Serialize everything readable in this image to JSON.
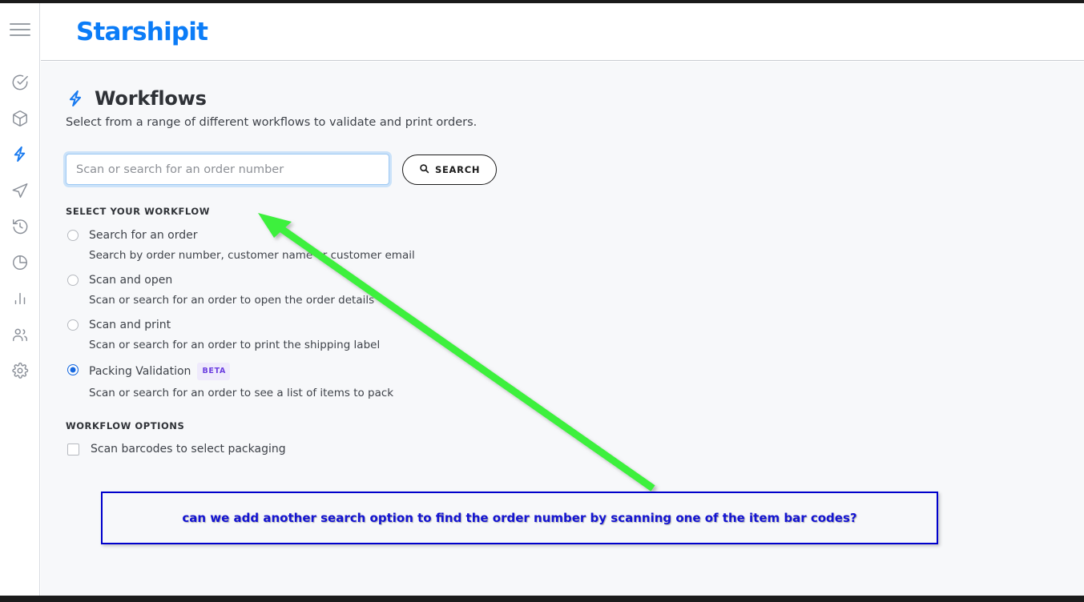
{
  "brand": {
    "logo_text": "Starshipit",
    "accent_color": "#0b7cf7",
    "active_nav_color": "#1a7bf0",
    "badge_color": "#6c3fe0",
    "annotation_color": "#0000cc",
    "arrow_color": "#3cf03c"
  },
  "sidebar": {
    "menu_label": "Menu",
    "items": [
      {
        "icon": "check-circle-icon",
        "label": "Orders awaiting fulfilment"
      },
      {
        "icon": "package-icon",
        "label": "Packages"
      },
      {
        "icon": "lightning-bolt-icon",
        "label": "Workflows",
        "active": true
      },
      {
        "icon": "paper-plane-icon",
        "label": "Shipments"
      },
      {
        "icon": "history-clock-icon",
        "label": "History"
      },
      {
        "icon": "pie-chart-icon",
        "label": "Reports"
      },
      {
        "icon": "bar-chart-icon",
        "label": "Analytics"
      },
      {
        "icon": "users-icon",
        "label": "Customers"
      },
      {
        "icon": "gear-icon",
        "label": "Settings"
      }
    ]
  },
  "page": {
    "icon": "lightning-bolt-icon",
    "title": "Workflows",
    "subtitle": "Select from a range of different workflows to validate and print orders."
  },
  "search": {
    "placeholder": "Scan or search for an order number",
    "value": "",
    "button_label": "SEARCH",
    "button_icon": "search-icon"
  },
  "workflow_section": {
    "heading": "SELECT YOUR WORKFLOW",
    "options": [
      {
        "title": "Search for an order",
        "description": "Search by order number, customer name or customer email",
        "selected": false,
        "badge": ""
      },
      {
        "title": "Scan and open",
        "description": "Scan or search for an order to open the order details",
        "selected": false,
        "badge": ""
      },
      {
        "title": "Scan and print",
        "description": "Scan or search for an order to print the shipping label",
        "selected": false,
        "badge": ""
      },
      {
        "title": "Packing Validation",
        "description": "Scan or search for an order to see a list of items to pack",
        "selected": true,
        "badge": "BETA"
      }
    ]
  },
  "options_section": {
    "heading": "WORKFLOW OPTIONS",
    "checkbox_label": "Scan barcodes to select packaging",
    "checkbox_checked": false
  },
  "annotation": {
    "text": "can we add another search option to find the order number by scanning one of the item bar codes?",
    "arrow_from": "815,610",
    "arrow_to": "325,266"
  }
}
